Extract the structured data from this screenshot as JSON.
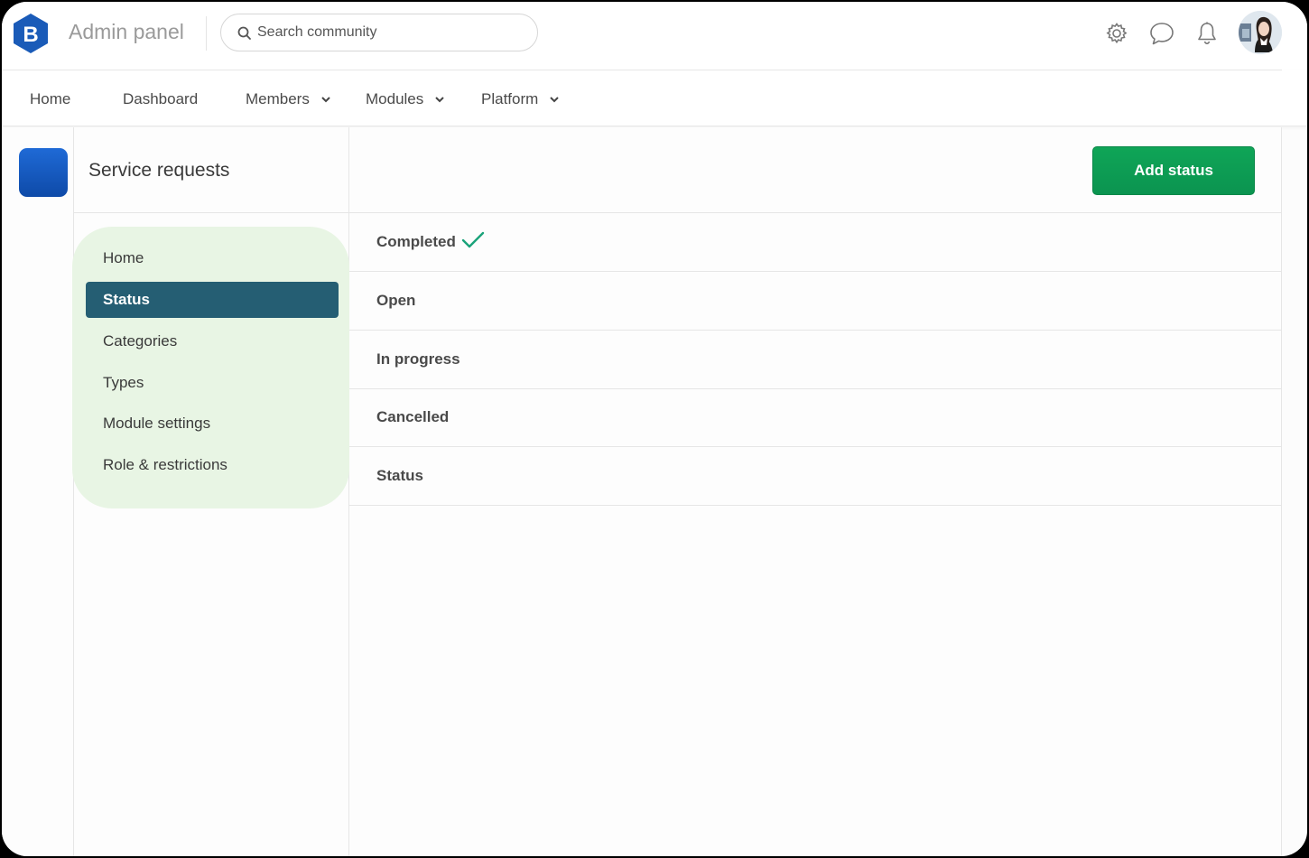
{
  "header": {
    "logo_letter": "B",
    "app_title": "Admin panel",
    "search": {
      "placeholder": "Search community",
      "value": ""
    },
    "icons": [
      "gear-icon",
      "chat-icon",
      "bell-icon"
    ]
  },
  "nav": {
    "items": [
      {
        "label": "Home"
      },
      {
        "label": "Dashboard"
      },
      {
        "label": "Members"
      },
      {
        "label": "Modules"
      },
      {
        "label": "Platform"
      }
    ]
  },
  "module": {
    "title": "Service requests",
    "menu": [
      {
        "label": "Home"
      },
      {
        "label": "Status"
      },
      {
        "label": "Categories"
      },
      {
        "label": "Types"
      },
      {
        "label": "Module settings"
      },
      {
        "label": "Role & restrictions"
      }
    ]
  },
  "main": {
    "add_button": "Add status",
    "statuses": [
      {
        "label": "Completed"
      },
      {
        "label": "Open"
      },
      {
        "label": "In progress"
      },
      {
        "label": "Cancelled"
      },
      {
        "label": "Status"
      }
    ]
  },
  "colors": {
    "brand_blue": "#1a5bb8",
    "menu_bg": "#e8f5e4",
    "active_item": "#255e73",
    "primary_button": "#0fa557",
    "check": "#1aa37a"
  }
}
